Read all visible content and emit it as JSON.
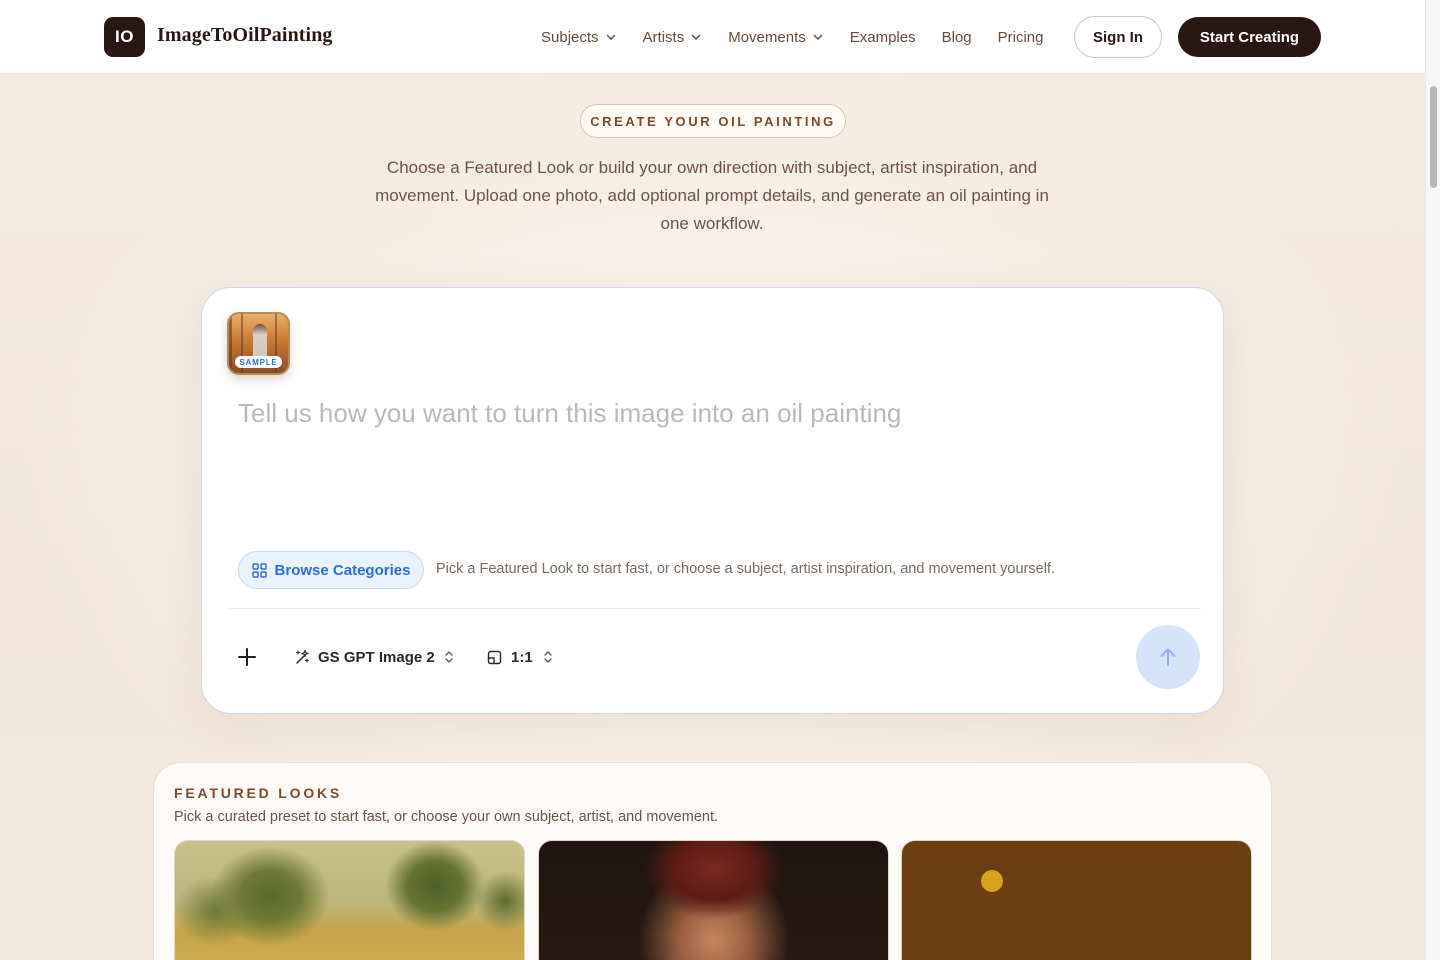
{
  "header": {
    "logo_badge": "IO",
    "logo_text": "ImageToOilPainting",
    "nav": [
      {
        "label": "Subjects",
        "has_dropdown": true
      },
      {
        "label": "Artists",
        "has_dropdown": true
      },
      {
        "label": "Movements",
        "has_dropdown": true
      },
      {
        "label": "Examples",
        "has_dropdown": false
      },
      {
        "label": "Blog",
        "has_dropdown": false
      },
      {
        "label": "Pricing",
        "has_dropdown": false
      }
    ],
    "sign_in": "Sign In",
    "start_creating": "Start Creating"
  },
  "hero": {
    "pill": "CREATE YOUR OIL PAINTING",
    "description": "Choose a Featured Look or build your own direction with subject, artist inspiration, and movement. Upload one photo, add optional prompt details, and generate an oil painting in one workflow."
  },
  "composer": {
    "sample_label": "SAMPLE",
    "prompt_placeholder": "Tell us how you want to turn this image into an oil painting",
    "prompt_value": "",
    "browse_label": "Browse Categories",
    "browse_hint": "Pick a Featured Look to start fast, or choose a subject, artist inspiration, and movement yourself.",
    "model": "GS GPT Image 2",
    "ratio": "1:1"
  },
  "featured": {
    "title": "FEATURED LOOKS",
    "subtitle": "Pick a curated preset to start fast, or choose your own subject, artist, and movement."
  },
  "colors": {
    "brand_dark": "#2a1713",
    "accent_blue": "#2a6fd6",
    "accent_brown": "#7a4a2c",
    "page_bg": "#f3e9dc"
  },
  "icons": {
    "nav_dropdown": "chevron-down-icon",
    "browse": "grid-icon",
    "add": "plus-icon",
    "model": "sparkles-icon",
    "ratio": "aspect-ratio-icon",
    "select": "chevron-up-down-icon",
    "send": "arrow-up-icon"
  }
}
